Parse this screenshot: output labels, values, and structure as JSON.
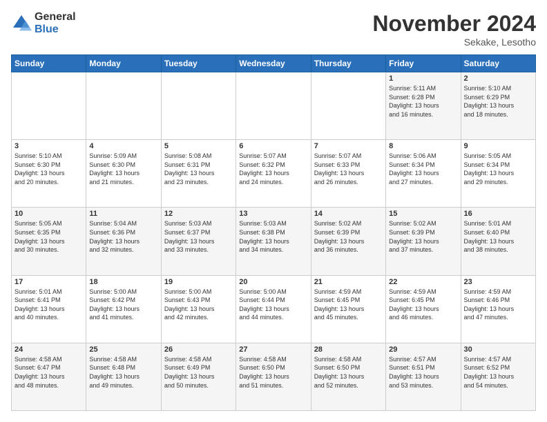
{
  "logo": {
    "general": "General",
    "blue": "Blue"
  },
  "header": {
    "month": "November 2024",
    "location": "Sekake, Lesotho"
  },
  "days": [
    "Sunday",
    "Monday",
    "Tuesday",
    "Wednesday",
    "Thursday",
    "Friday",
    "Saturday"
  ],
  "weeks": [
    [
      {
        "day": "",
        "content": ""
      },
      {
        "day": "",
        "content": ""
      },
      {
        "day": "",
        "content": ""
      },
      {
        "day": "",
        "content": ""
      },
      {
        "day": "",
        "content": ""
      },
      {
        "day": "1",
        "content": "Sunrise: 5:11 AM\nSunset: 6:28 PM\nDaylight: 13 hours\nand 16 minutes."
      },
      {
        "day": "2",
        "content": "Sunrise: 5:10 AM\nSunset: 6:29 PM\nDaylight: 13 hours\nand 18 minutes."
      }
    ],
    [
      {
        "day": "3",
        "content": "Sunrise: 5:10 AM\nSunset: 6:30 PM\nDaylight: 13 hours\nand 20 minutes."
      },
      {
        "day": "4",
        "content": "Sunrise: 5:09 AM\nSunset: 6:30 PM\nDaylight: 13 hours\nand 21 minutes."
      },
      {
        "day": "5",
        "content": "Sunrise: 5:08 AM\nSunset: 6:31 PM\nDaylight: 13 hours\nand 23 minutes."
      },
      {
        "day": "6",
        "content": "Sunrise: 5:07 AM\nSunset: 6:32 PM\nDaylight: 13 hours\nand 24 minutes."
      },
      {
        "day": "7",
        "content": "Sunrise: 5:07 AM\nSunset: 6:33 PM\nDaylight: 13 hours\nand 26 minutes."
      },
      {
        "day": "8",
        "content": "Sunrise: 5:06 AM\nSunset: 6:34 PM\nDaylight: 13 hours\nand 27 minutes."
      },
      {
        "day": "9",
        "content": "Sunrise: 5:05 AM\nSunset: 6:34 PM\nDaylight: 13 hours\nand 29 minutes."
      }
    ],
    [
      {
        "day": "10",
        "content": "Sunrise: 5:05 AM\nSunset: 6:35 PM\nDaylight: 13 hours\nand 30 minutes."
      },
      {
        "day": "11",
        "content": "Sunrise: 5:04 AM\nSunset: 6:36 PM\nDaylight: 13 hours\nand 32 minutes."
      },
      {
        "day": "12",
        "content": "Sunrise: 5:03 AM\nSunset: 6:37 PM\nDaylight: 13 hours\nand 33 minutes."
      },
      {
        "day": "13",
        "content": "Sunrise: 5:03 AM\nSunset: 6:38 PM\nDaylight: 13 hours\nand 34 minutes."
      },
      {
        "day": "14",
        "content": "Sunrise: 5:02 AM\nSunset: 6:39 PM\nDaylight: 13 hours\nand 36 minutes."
      },
      {
        "day": "15",
        "content": "Sunrise: 5:02 AM\nSunset: 6:39 PM\nDaylight: 13 hours\nand 37 minutes."
      },
      {
        "day": "16",
        "content": "Sunrise: 5:01 AM\nSunset: 6:40 PM\nDaylight: 13 hours\nand 38 minutes."
      }
    ],
    [
      {
        "day": "17",
        "content": "Sunrise: 5:01 AM\nSunset: 6:41 PM\nDaylight: 13 hours\nand 40 minutes."
      },
      {
        "day": "18",
        "content": "Sunrise: 5:00 AM\nSunset: 6:42 PM\nDaylight: 13 hours\nand 41 minutes."
      },
      {
        "day": "19",
        "content": "Sunrise: 5:00 AM\nSunset: 6:43 PM\nDaylight: 13 hours\nand 42 minutes."
      },
      {
        "day": "20",
        "content": "Sunrise: 5:00 AM\nSunset: 6:44 PM\nDaylight: 13 hours\nand 44 minutes."
      },
      {
        "day": "21",
        "content": "Sunrise: 4:59 AM\nSunset: 6:45 PM\nDaylight: 13 hours\nand 45 minutes."
      },
      {
        "day": "22",
        "content": "Sunrise: 4:59 AM\nSunset: 6:45 PM\nDaylight: 13 hours\nand 46 minutes."
      },
      {
        "day": "23",
        "content": "Sunrise: 4:59 AM\nSunset: 6:46 PM\nDaylight: 13 hours\nand 47 minutes."
      }
    ],
    [
      {
        "day": "24",
        "content": "Sunrise: 4:58 AM\nSunset: 6:47 PM\nDaylight: 13 hours\nand 48 minutes."
      },
      {
        "day": "25",
        "content": "Sunrise: 4:58 AM\nSunset: 6:48 PM\nDaylight: 13 hours\nand 49 minutes."
      },
      {
        "day": "26",
        "content": "Sunrise: 4:58 AM\nSunset: 6:49 PM\nDaylight: 13 hours\nand 50 minutes."
      },
      {
        "day": "27",
        "content": "Sunrise: 4:58 AM\nSunset: 6:50 PM\nDaylight: 13 hours\nand 51 minutes."
      },
      {
        "day": "28",
        "content": "Sunrise: 4:58 AM\nSunset: 6:50 PM\nDaylight: 13 hours\nand 52 minutes."
      },
      {
        "day": "29",
        "content": "Sunrise: 4:57 AM\nSunset: 6:51 PM\nDaylight: 13 hours\nand 53 minutes."
      },
      {
        "day": "30",
        "content": "Sunrise: 4:57 AM\nSunset: 6:52 PM\nDaylight: 13 hours\nand 54 minutes."
      }
    ]
  ]
}
